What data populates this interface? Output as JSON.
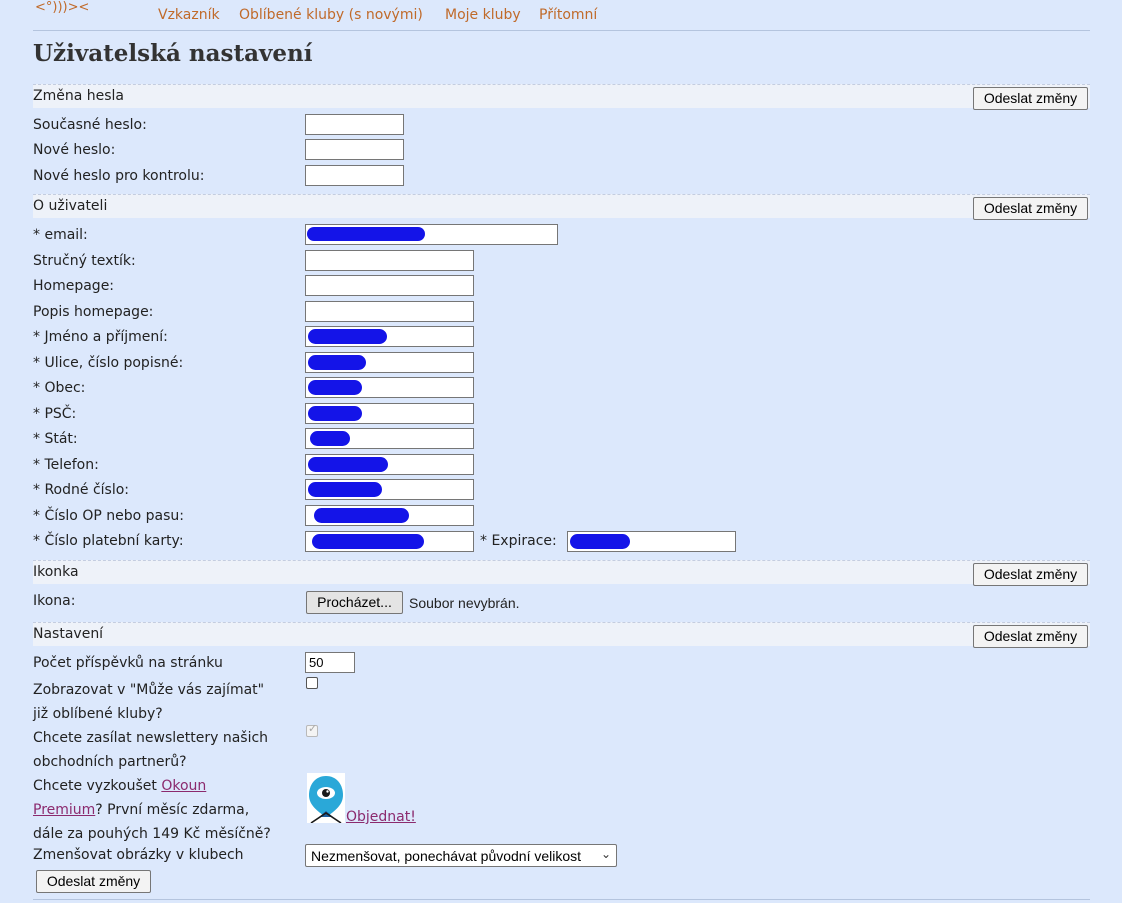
{
  "nav": {
    "logo": "<°)))><",
    "links": [
      "Vzkazník",
      "Oblíbené kluby  (s novými)",
      "Moje kluby",
      "Přítomní"
    ]
  },
  "page_title": "Uživatelská nastavení",
  "submit_label": "Odeslat změny",
  "password_section": {
    "title": "Změna hesla",
    "fields": [
      "Současné heslo:",
      "Nové heslo:",
      "Nové heslo pro kontrolu:"
    ]
  },
  "user_section": {
    "title": "O uživateli",
    "fields": [
      {
        "label": "* email:",
        "value": ""
      },
      {
        "label": "Stručný textík:",
        "value": ""
      },
      {
        "label": "Homepage:",
        "value": ""
      },
      {
        "label": "Popis homepage:",
        "value": ""
      },
      {
        "label": "* Jméno a příjmení:",
        "value": ""
      },
      {
        "label": "* Ulice, číslo popisné:",
        "value": ""
      },
      {
        "label": "* Obec:",
        "value": ""
      },
      {
        "label": "* PSČ:",
        "value": ""
      },
      {
        "label": "* Stát:",
        "value": ""
      },
      {
        "label": "* Telefon:",
        "value": ""
      },
      {
        "label": "* Rodné číslo:",
        "value": ""
      },
      {
        "label": "* Číslo OP nebo pasu:",
        "value": ""
      },
      {
        "label": "* Číslo platební karty:",
        "value": ""
      }
    ],
    "expiration_label": "* Expirace:"
  },
  "icon_section": {
    "title": "Ikonka",
    "field_label": "Ikona:",
    "browse_label": "Procházet...",
    "no_file_text": "Soubor nevybrán."
  },
  "settings_section": {
    "title": "Nastavení",
    "posts_per_page_label": "Počet příspěvků na stránku",
    "posts_per_page_value": "50",
    "show_favorites_label_1": "Zobrazovat v \"Může vás zajímat\"",
    "show_favorites_label_2": "již oblíbené kluby?",
    "show_favorites_checked": false,
    "newsletter_label_1": "Chcete zasílat newslettery našich",
    "newsletter_label_2": "obchodních partnerů?",
    "newsletter_checked": true,
    "premium_text_1": "Chcete vyzkoušet ",
    "premium_link": "Okoun",
    "premium_link_2": "Premium",
    "premium_text_2": "? První měsíc zdarma,",
    "premium_text_3": "dále za pouhých 149 Kč měsíčně?",
    "order_link": "Objednat!",
    "shrink_images_label": "Zmenšovat obrázky v klubech",
    "shrink_images_value": "Nezmenšovat, ponechávat původní velikost"
  },
  "colors": {
    "background": "#dce8fc",
    "link": "#c06a2a",
    "premium_link": "#8b2a6e",
    "redaction": "#1414e8"
  }
}
